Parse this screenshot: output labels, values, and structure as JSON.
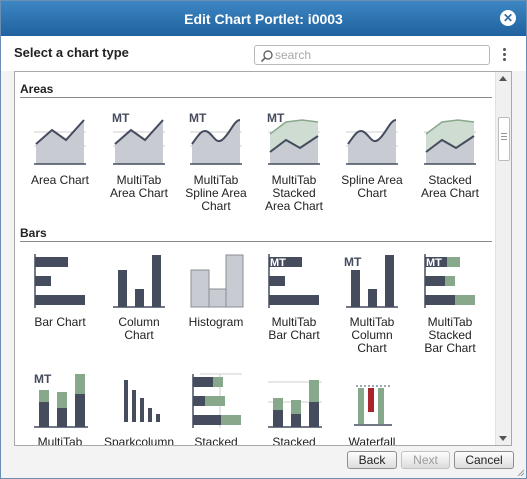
{
  "dialog": {
    "title": "Edit Chart Portlet: i0003",
    "close_icon": "close-circle-icon"
  },
  "toolbar": {
    "select_label": "Select a chart type",
    "search_placeholder": "search",
    "search_value": "",
    "menu_icon": "kebab-menu-icon"
  },
  "sections": {
    "areas": {
      "title": "Areas",
      "items": [
        {
          "label_lines": [
            "Area Chart"
          ],
          "icon": "area-chart-icon"
        },
        {
          "label_lines": [
            "MultiTab",
            "Area Chart"
          ],
          "icon": "multitab-area-chart-icon",
          "badge": "MT"
        },
        {
          "label_lines": [
            "MultiTab",
            "Spline Area",
            "Chart"
          ],
          "icon": "multitab-spline-area-chart-icon",
          "badge": "MT"
        },
        {
          "label_lines": [
            "MultiTab",
            "Stacked",
            "Area Chart"
          ],
          "icon": "multitab-stacked-area-chart-icon",
          "badge": "MT"
        },
        {
          "label_lines": [
            "Spline Area",
            "Chart"
          ],
          "icon": "spline-area-chart-icon"
        },
        {
          "label_lines": [
            "Stacked",
            "Area Chart"
          ],
          "icon": "stacked-area-chart-icon"
        }
      ]
    },
    "bars": {
      "title": "Bars",
      "items": [
        {
          "label_lines": [
            "Bar Chart"
          ],
          "icon": "bar-chart-icon"
        },
        {
          "label_lines": [
            "Column",
            "Chart"
          ],
          "icon": "column-chart-icon"
        },
        {
          "label_lines": [
            "Histogram"
          ],
          "icon": "histogram-icon"
        },
        {
          "label_lines": [
            "MultiTab",
            "Bar Chart"
          ],
          "icon": "multitab-bar-chart-icon",
          "badge": "MT"
        },
        {
          "label_lines": [
            "MultiTab",
            "Column",
            "Chart"
          ],
          "icon": "multitab-column-chart-icon",
          "badge": "MT"
        },
        {
          "label_lines": [
            "MultiTab",
            "Stacked",
            "Bar Chart"
          ],
          "icon": "multitab-stacked-bar-chart-icon",
          "badge": "MT"
        },
        {
          "label_lines": [
            "MultiTab"
          ],
          "icon": "multitab-stacked-column-chart-icon",
          "badge": "MT"
        },
        {
          "label_lines": [
            "Sparkcolumn"
          ],
          "icon": "sparkcolumn-icon"
        },
        {
          "label_lines": [
            "Stacked"
          ],
          "icon": "stacked-bar-chart-icon"
        },
        {
          "label_lines": [
            "Stacked"
          ],
          "icon": "stacked-column-chart-icon"
        },
        {
          "label_lines": [
            "Waterfall"
          ],
          "icon": "waterfall-chart-icon"
        }
      ]
    }
  },
  "footer": {
    "back_label": "Back",
    "next_label": "Next",
    "cancel_label": "Cancel"
  },
  "colors": {
    "title_bar": "#2a6ba6",
    "series_dark": "#454c5e",
    "series_green": "#88a88b",
    "area_fill": "#c9cbd2",
    "waterfall_red": "#a8242a"
  }
}
